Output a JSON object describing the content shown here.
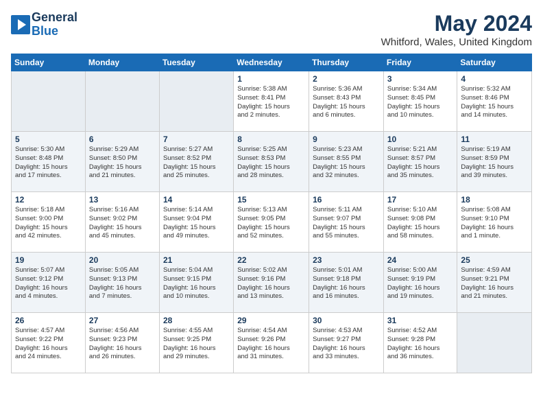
{
  "logo": {
    "line1": "General",
    "line2": "Blue"
  },
  "title": "May 2024",
  "location": "Whitford, Wales, United Kingdom",
  "days_of_week": [
    "Sunday",
    "Monday",
    "Tuesday",
    "Wednesday",
    "Thursday",
    "Friday",
    "Saturday"
  ],
  "weeks": [
    [
      {
        "day": "",
        "info": ""
      },
      {
        "day": "",
        "info": ""
      },
      {
        "day": "",
        "info": ""
      },
      {
        "day": "1",
        "info": "Sunrise: 5:38 AM\nSunset: 8:41 PM\nDaylight: 15 hours\nand 2 minutes."
      },
      {
        "day": "2",
        "info": "Sunrise: 5:36 AM\nSunset: 8:43 PM\nDaylight: 15 hours\nand 6 minutes."
      },
      {
        "day": "3",
        "info": "Sunrise: 5:34 AM\nSunset: 8:45 PM\nDaylight: 15 hours\nand 10 minutes."
      },
      {
        "day": "4",
        "info": "Sunrise: 5:32 AM\nSunset: 8:46 PM\nDaylight: 15 hours\nand 14 minutes."
      }
    ],
    [
      {
        "day": "5",
        "info": "Sunrise: 5:30 AM\nSunset: 8:48 PM\nDaylight: 15 hours\nand 17 minutes."
      },
      {
        "day": "6",
        "info": "Sunrise: 5:29 AM\nSunset: 8:50 PM\nDaylight: 15 hours\nand 21 minutes."
      },
      {
        "day": "7",
        "info": "Sunrise: 5:27 AM\nSunset: 8:52 PM\nDaylight: 15 hours\nand 25 minutes."
      },
      {
        "day": "8",
        "info": "Sunrise: 5:25 AM\nSunset: 8:53 PM\nDaylight: 15 hours\nand 28 minutes."
      },
      {
        "day": "9",
        "info": "Sunrise: 5:23 AM\nSunset: 8:55 PM\nDaylight: 15 hours\nand 32 minutes."
      },
      {
        "day": "10",
        "info": "Sunrise: 5:21 AM\nSunset: 8:57 PM\nDaylight: 15 hours\nand 35 minutes."
      },
      {
        "day": "11",
        "info": "Sunrise: 5:19 AM\nSunset: 8:59 PM\nDaylight: 15 hours\nand 39 minutes."
      }
    ],
    [
      {
        "day": "12",
        "info": "Sunrise: 5:18 AM\nSunset: 9:00 PM\nDaylight: 15 hours\nand 42 minutes."
      },
      {
        "day": "13",
        "info": "Sunrise: 5:16 AM\nSunset: 9:02 PM\nDaylight: 15 hours\nand 45 minutes."
      },
      {
        "day": "14",
        "info": "Sunrise: 5:14 AM\nSunset: 9:04 PM\nDaylight: 15 hours\nand 49 minutes."
      },
      {
        "day": "15",
        "info": "Sunrise: 5:13 AM\nSunset: 9:05 PM\nDaylight: 15 hours\nand 52 minutes."
      },
      {
        "day": "16",
        "info": "Sunrise: 5:11 AM\nSunset: 9:07 PM\nDaylight: 15 hours\nand 55 minutes."
      },
      {
        "day": "17",
        "info": "Sunrise: 5:10 AM\nSunset: 9:08 PM\nDaylight: 15 hours\nand 58 minutes."
      },
      {
        "day": "18",
        "info": "Sunrise: 5:08 AM\nSunset: 9:10 PM\nDaylight: 16 hours\nand 1 minute."
      }
    ],
    [
      {
        "day": "19",
        "info": "Sunrise: 5:07 AM\nSunset: 9:12 PM\nDaylight: 16 hours\nand 4 minutes."
      },
      {
        "day": "20",
        "info": "Sunrise: 5:05 AM\nSunset: 9:13 PM\nDaylight: 16 hours\nand 7 minutes."
      },
      {
        "day": "21",
        "info": "Sunrise: 5:04 AM\nSunset: 9:15 PM\nDaylight: 16 hours\nand 10 minutes."
      },
      {
        "day": "22",
        "info": "Sunrise: 5:02 AM\nSunset: 9:16 PM\nDaylight: 16 hours\nand 13 minutes."
      },
      {
        "day": "23",
        "info": "Sunrise: 5:01 AM\nSunset: 9:18 PM\nDaylight: 16 hours\nand 16 minutes."
      },
      {
        "day": "24",
        "info": "Sunrise: 5:00 AM\nSunset: 9:19 PM\nDaylight: 16 hours\nand 19 minutes."
      },
      {
        "day": "25",
        "info": "Sunrise: 4:59 AM\nSunset: 9:21 PM\nDaylight: 16 hours\nand 21 minutes."
      }
    ],
    [
      {
        "day": "26",
        "info": "Sunrise: 4:57 AM\nSunset: 9:22 PM\nDaylight: 16 hours\nand 24 minutes."
      },
      {
        "day": "27",
        "info": "Sunrise: 4:56 AM\nSunset: 9:23 PM\nDaylight: 16 hours\nand 26 minutes."
      },
      {
        "day": "28",
        "info": "Sunrise: 4:55 AM\nSunset: 9:25 PM\nDaylight: 16 hours\nand 29 minutes."
      },
      {
        "day": "29",
        "info": "Sunrise: 4:54 AM\nSunset: 9:26 PM\nDaylight: 16 hours\nand 31 minutes."
      },
      {
        "day": "30",
        "info": "Sunrise: 4:53 AM\nSunset: 9:27 PM\nDaylight: 16 hours\nand 33 minutes."
      },
      {
        "day": "31",
        "info": "Sunrise: 4:52 AM\nSunset: 9:28 PM\nDaylight: 16 hours\nand 36 minutes."
      },
      {
        "day": "",
        "info": ""
      }
    ]
  ]
}
